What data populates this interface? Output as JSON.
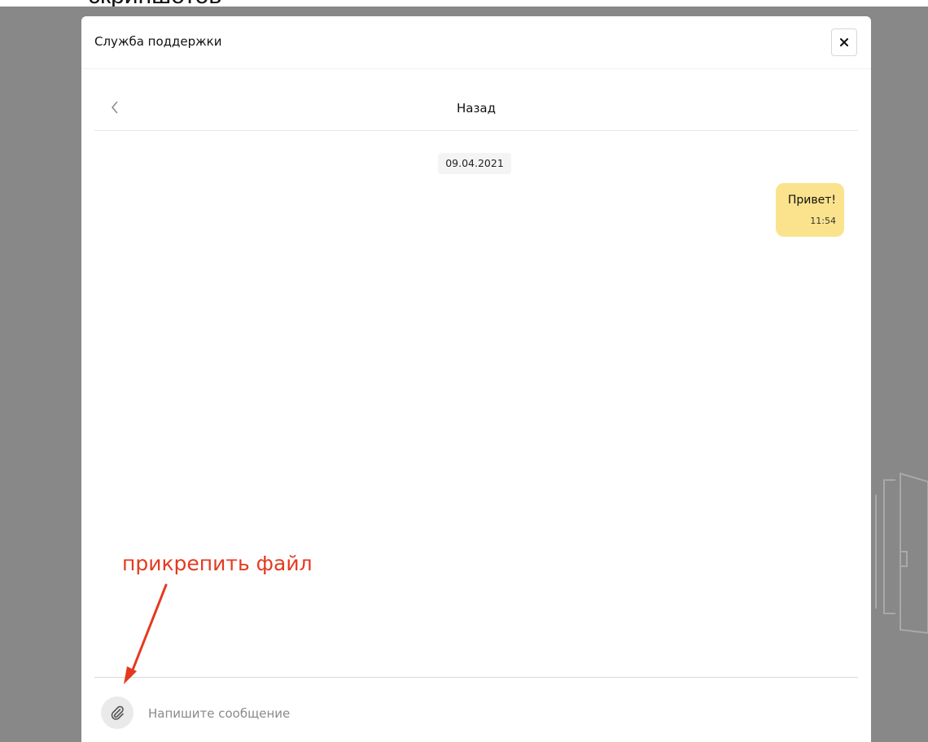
{
  "page_caption_partial": "скриншотов",
  "modal": {
    "title": "Служба поддержки",
    "close_label": "×"
  },
  "nav": {
    "back_icon": "chevron-left-icon",
    "title": "Назад"
  },
  "chat": {
    "date": "09.04.2021",
    "messages": [
      {
        "text": "Привет!",
        "time": "11:54",
        "from": "user"
      }
    ]
  },
  "composer": {
    "attach_icon": "paperclip-icon",
    "placeholder": "Напишите сообщение",
    "value": ""
  },
  "annotation": {
    "label": "прикрепить файл",
    "color": "#e5391f"
  },
  "colors": {
    "bubble": "#fbe38d",
    "overlay": "#888888"
  }
}
